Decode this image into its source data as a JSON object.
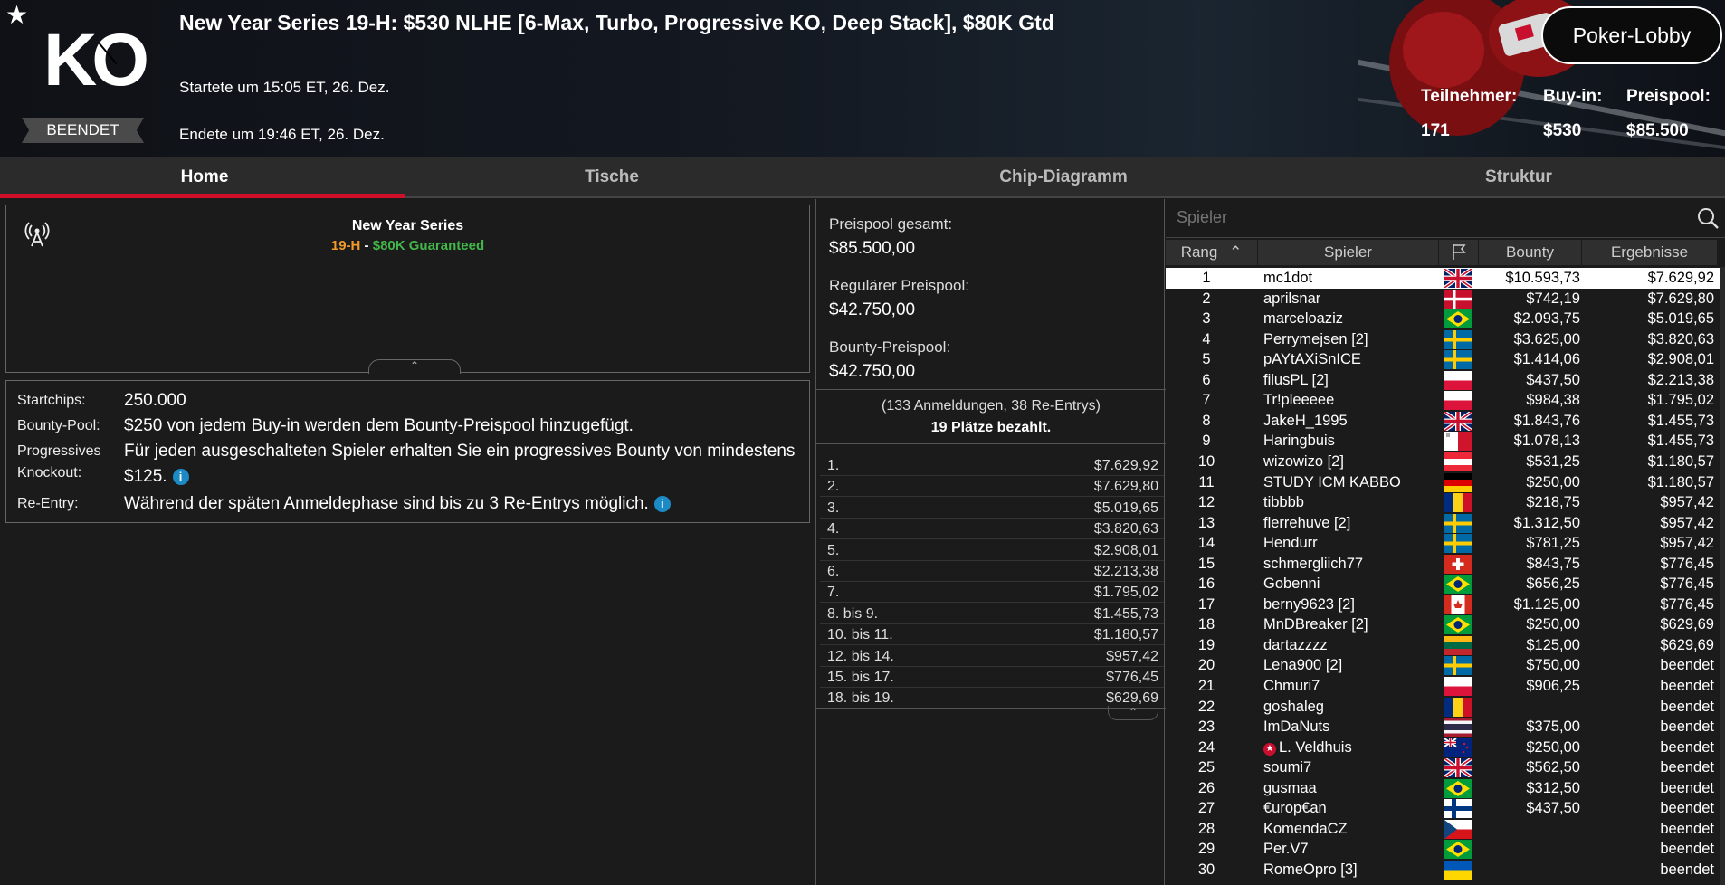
{
  "header": {
    "title": "New Year Series 19-H: $530 NLHE [6-Max, Turbo, Progressive KO, Deep Stack], $80K Gtd",
    "started": "Startete um 15:05 ET, 26. Dez.",
    "ended": "Endete um 19:46 ET, 26. Dez.",
    "logo": "KO",
    "status": "BEENDET",
    "lobby_button": "Poker-Lobby",
    "stats": [
      {
        "label": "Teilnehmer:",
        "value": "171"
      },
      {
        "label": "Buy-in:",
        "value": "$530"
      },
      {
        "label": "Preispool:",
        "value": "$85.500"
      }
    ]
  },
  "tabs": [
    "Home",
    "Tische",
    "Chip-Diagramm",
    "Struktur"
  ],
  "series": {
    "name": "New Year Series",
    "event": "19-H",
    "sep": " - ",
    "guarantee": "$80K Guaranteed"
  },
  "info": [
    {
      "label": "Startchips:",
      "value": "250.000"
    },
    {
      "label": "Bounty-Pool:",
      "value": "$250 von jedem Buy-in werden dem Bounty-Preispool hinzugefügt."
    },
    {
      "label": "Progressives Knockout:",
      "value": "Für jeden ausgeschalteten Spieler erhalten Sie ein progressives Bounty von mindestens $125."
    },
    {
      "label": "Re-Entry:",
      "value": "Während der späten Anmeldephase sind bis zu 3 Re-Entrys möglich."
    }
  ],
  "prizepool": {
    "total_label": "Preispool gesamt:",
    "total": "$85.500,00",
    "regular_label": "Regulärer Preispool:",
    "regular": "$42.750,00",
    "bounty_label": "Bounty-Preispool:",
    "bounty": "$42.750,00",
    "entries": "(133 Anmeldungen, 38 Re-Entrys)",
    "paid": "19 Plätze bezahlt."
  },
  "payouts": [
    {
      "place": "1.",
      "amount": "$7.629,92"
    },
    {
      "place": "2.",
      "amount": "$7.629,80"
    },
    {
      "place": "3.",
      "amount": "$5.019,65"
    },
    {
      "place": "4.",
      "amount": "$3.820,63"
    },
    {
      "place": "5.",
      "amount": "$2.908,01"
    },
    {
      "place": "6.",
      "amount": "$2.213,38"
    },
    {
      "place": "7.",
      "amount": "$1.795,02"
    },
    {
      "place": "8. bis 9.",
      "amount": "$1.455,73"
    },
    {
      "place": "10. bis 11.",
      "amount": "$1.180,57"
    },
    {
      "place": "12. bis 14.",
      "amount": "$957,42"
    },
    {
      "place": "15. bis 17.",
      "amount": "$776,45"
    },
    {
      "place": "18. bis 19.",
      "amount": "$629,69"
    }
  ],
  "players_panel": {
    "search_placeholder": "Spieler",
    "columns": [
      "Rang",
      "Spieler",
      "Bounty",
      "Ergebnisse"
    ]
  },
  "players": [
    {
      "rank": "1",
      "name": "mc1dot",
      "flag": "gb",
      "bounty": "$10.593,73",
      "result": "$7.629,92"
    },
    {
      "rank": "2",
      "name": "aprilsnar",
      "flag": "dk",
      "bounty": "$742,19",
      "result": "$7.629,80"
    },
    {
      "rank": "3",
      "name": "marceloaziz",
      "flag": "br",
      "bounty": "$2.093,75",
      "result": "$5.019,65"
    },
    {
      "rank": "4",
      "name": "Perrymejsen [2]",
      "flag": "se",
      "bounty": "$3.625,00",
      "result": "$3.820,63"
    },
    {
      "rank": "5",
      "name": "pAYtAXiSnICE",
      "flag": "se",
      "bounty": "$1.414,06",
      "result": "$2.908,01"
    },
    {
      "rank": "6",
      "name": "filusPL [2]",
      "flag": "pl",
      "bounty": "$437,50",
      "result": "$2.213,38"
    },
    {
      "rank": "7",
      "name": "Tr!pleeeee",
      "flag": "pl",
      "bounty": "$984,38",
      "result": "$1.795,02"
    },
    {
      "rank": "8",
      "name": "JakeH_1995",
      "flag": "gb",
      "bounty": "$1.843,76",
      "result": "$1.455,73"
    },
    {
      "rank": "9",
      "name": "Haringbuis",
      "flag": "mt",
      "bounty": "$1.078,13",
      "result": "$1.455,73"
    },
    {
      "rank": "10",
      "name": "wizowizo [2]",
      "flag": "at",
      "bounty": "$531,25",
      "result": "$1.180,57"
    },
    {
      "rank": "11",
      "name": "STUDY ICM KABBO",
      "flag": "de",
      "bounty": "$250,00",
      "result": "$1.180,57"
    },
    {
      "rank": "12",
      "name": "tibbbb",
      "flag": "ro",
      "bounty": "$218,75",
      "result": "$957,42"
    },
    {
      "rank": "13",
      "name": "flerrehuve [2]",
      "flag": "se",
      "bounty": "$1.312,50",
      "result": "$957,42"
    },
    {
      "rank": "14",
      "name": "Hendurr",
      "flag": "se",
      "bounty": "$781,25",
      "result": "$957,42"
    },
    {
      "rank": "15",
      "name": "schmergliich77",
      "flag": "ch",
      "bounty": "$843,75",
      "result": "$776,45"
    },
    {
      "rank": "16",
      "name": "Gobenni",
      "flag": "br",
      "bounty": "$656,25",
      "result": "$776,45"
    },
    {
      "rank": "17",
      "name": "berny9623 [2]",
      "flag": "ca",
      "bounty": "$1.125,00",
      "result": "$776,45"
    },
    {
      "rank": "18",
      "name": "MnDBreaker [2]",
      "flag": "br",
      "bounty": "$250,00",
      "result": "$629,69"
    },
    {
      "rank": "19",
      "name": "dartazzzz",
      "flag": "lt",
      "bounty": "$125,00",
      "result": "$629,69"
    },
    {
      "rank": "20",
      "name": "Lena900 [2]",
      "flag": "se",
      "bounty": "$750,00",
      "result": "beendet"
    },
    {
      "rank": "21",
      "name": "Chmuri7",
      "flag": "pl",
      "bounty": "$906,25",
      "result": "beendet"
    },
    {
      "rank": "22",
      "name": "goshaleg",
      "flag": "ro",
      "bounty": "",
      "result": "beendet"
    },
    {
      "rank": "23",
      "name": "ImDaNuts",
      "flag": "th",
      "bounty": "$375,00",
      "result": "beendet"
    },
    {
      "rank": "24",
      "name": "L. Veldhuis",
      "flag": "nz",
      "bounty": "$250,00",
      "result": "beendet",
      "pro": true
    },
    {
      "rank": "25",
      "name": "soumi7",
      "flag": "gb",
      "bounty": "$562,50",
      "result": "beendet"
    },
    {
      "rank": "26",
      "name": "gusmaa",
      "flag": "br",
      "bounty": "$312,50",
      "result": "beendet"
    },
    {
      "rank": "27",
      "name": "€urop€an",
      "flag": "fi",
      "bounty": "$437,50",
      "result": "beendet"
    },
    {
      "rank": "28",
      "name": "KomendaCZ",
      "flag": "cz",
      "bounty": "",
      "result": "beendet"
    },
    {
      "rank": "29",
      "name": "Per.V7",
      "flag": "br",
      "bounty": "",
      "result": "beendet"
    },
    {
      "rank": "30",
      "name": "RomeOpro [3]",
      "flag": "ua",
      "bounty": "",
      "result": "beendet"
    }
  ],
  "colors": {
    "accent": "#d0102a",
    "selected_row": "#ffffff",
    "info_icon": "#1c8ac4",
    "event_orange": "#f09a2a",
    "guarantee_green": "#43b649"
  }
}
